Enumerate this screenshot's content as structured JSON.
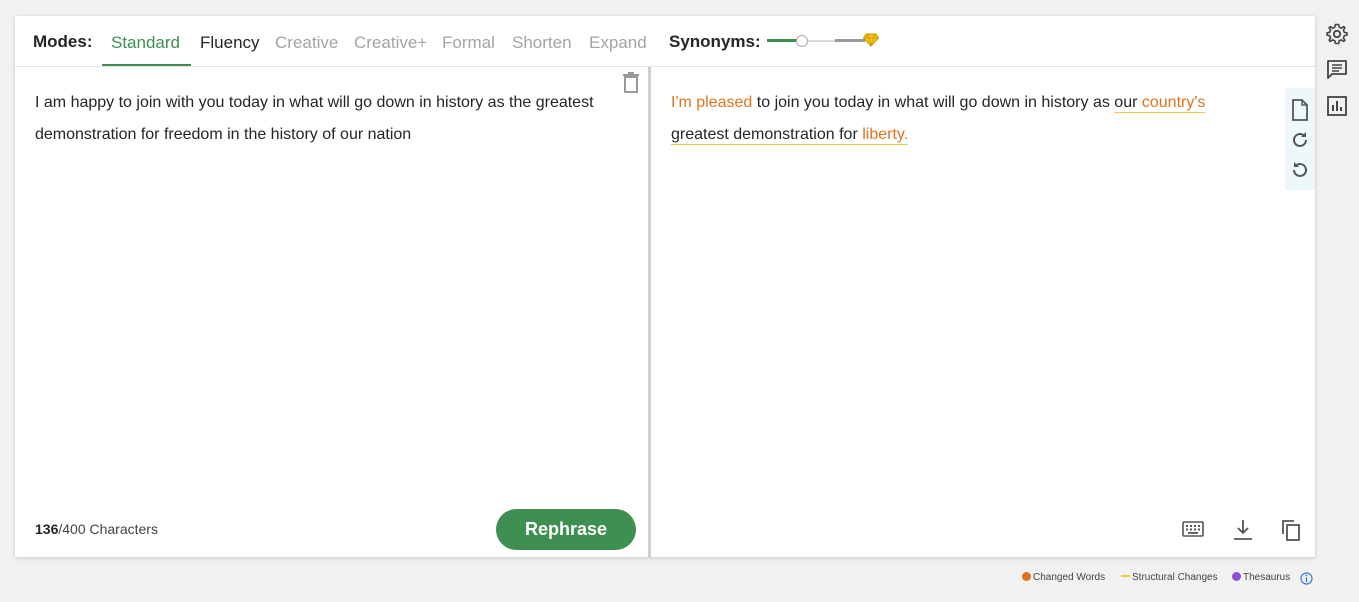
{
  "modes": {
    "label": "Modes:",
    "tabs": [
      {
        "label": "Standard",
        "state": "active"
      },
      {
        "label": "Fluency",
        "state": "enabled"
      },
      {
        "label": "Creative",
        "state": "locked"
      },
      {
        "label": "Creative+",
        "state": "locked"
      },
      {
        "label": "Formal",
        "state": "locked"
      },
      {
        "label": "Shorten",
        "state": "locked"
      },
      {
        "label": "Expand",
        "state": "locked"
      }
    ]
  },
  "synonyms": {
    "label": "Synonyms:",
    "level": 0.3,
    "premium_icon": "diamond-icon"
  },
  "input": {
    "text": "I am happy to join with you today in what will go down in history as the greatest demonstration for freedom in the history of our nation",
    "char_count": "136",
    "char_limit": "/400 Characters"
  },
  "rephrase_label": "Rephrase",
  "output": {
    "segments": [
      {
        "text": "I'm pleased",
        "kind": "changed"
      },
      {
        "text": " to join you today in what will go down in history as ",
        "kind": "plain"
      },
      {
        "text": "our ",
        "kind": "structural"
      },
      {
        "text": "country's",
        "kind": "changed-structural"
      },
      {
        "text": " ",
        "kind": "plain"
      },
      {
        "text": "greatest demonstration for ",
        "kind": "structural"
      },
      {
        "text": "liberty.",
        "kind": "changed-structural"
      }
    ]
  },
  "legend": {
    "changed": "Changed Words",
    "structural": "Structural Changes",
    "thesaurus": "Thesaurus"
  },
  "colors": {
    "accent": "#3f8e52",
    "changed": "#e2731c",
    "structural": "#f0c84a",
    "thesaurus": "#8e4fd6"
  }
}
